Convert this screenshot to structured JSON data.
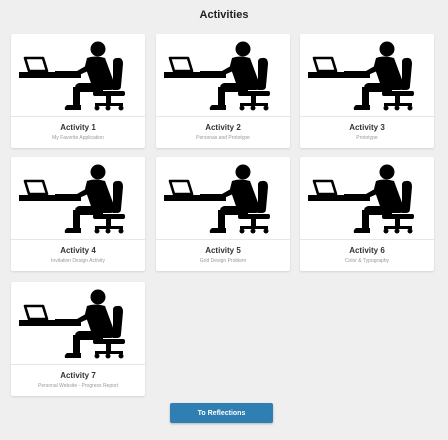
{
  "page": {
    "title": "Activities"
  },
  "activities": [
    {
      "name": "Activity 1",
      "description": "My Favorite Application"
    },
    {
      "name": "Activity 2",
      "description": "Personas and Prototype"
    },
    {
      "name": "Activity 3",
      "description": "Prototype"
    },
    {
      "name": "Activity 4",
      "description": "Invitation Design Activity"
    },
    {
      "name": "Activity 5",
      "description": "Grid Design Problem"
    },
    {
      "name": "Activity 6",
      "description": "Color & Typography"
    },
    {
      "name": "Activity 7",
      "description": "Personal Website - Progress Report"
    }
  ],
  "footer": {
    "button_label": "To Reflections"
  },
  "icons": {
    "card_image": "person-at-computer-icon"
  },
  "colors": {
    "button": "#2f7fb2",
    "background": "#efefef"
  }
}
